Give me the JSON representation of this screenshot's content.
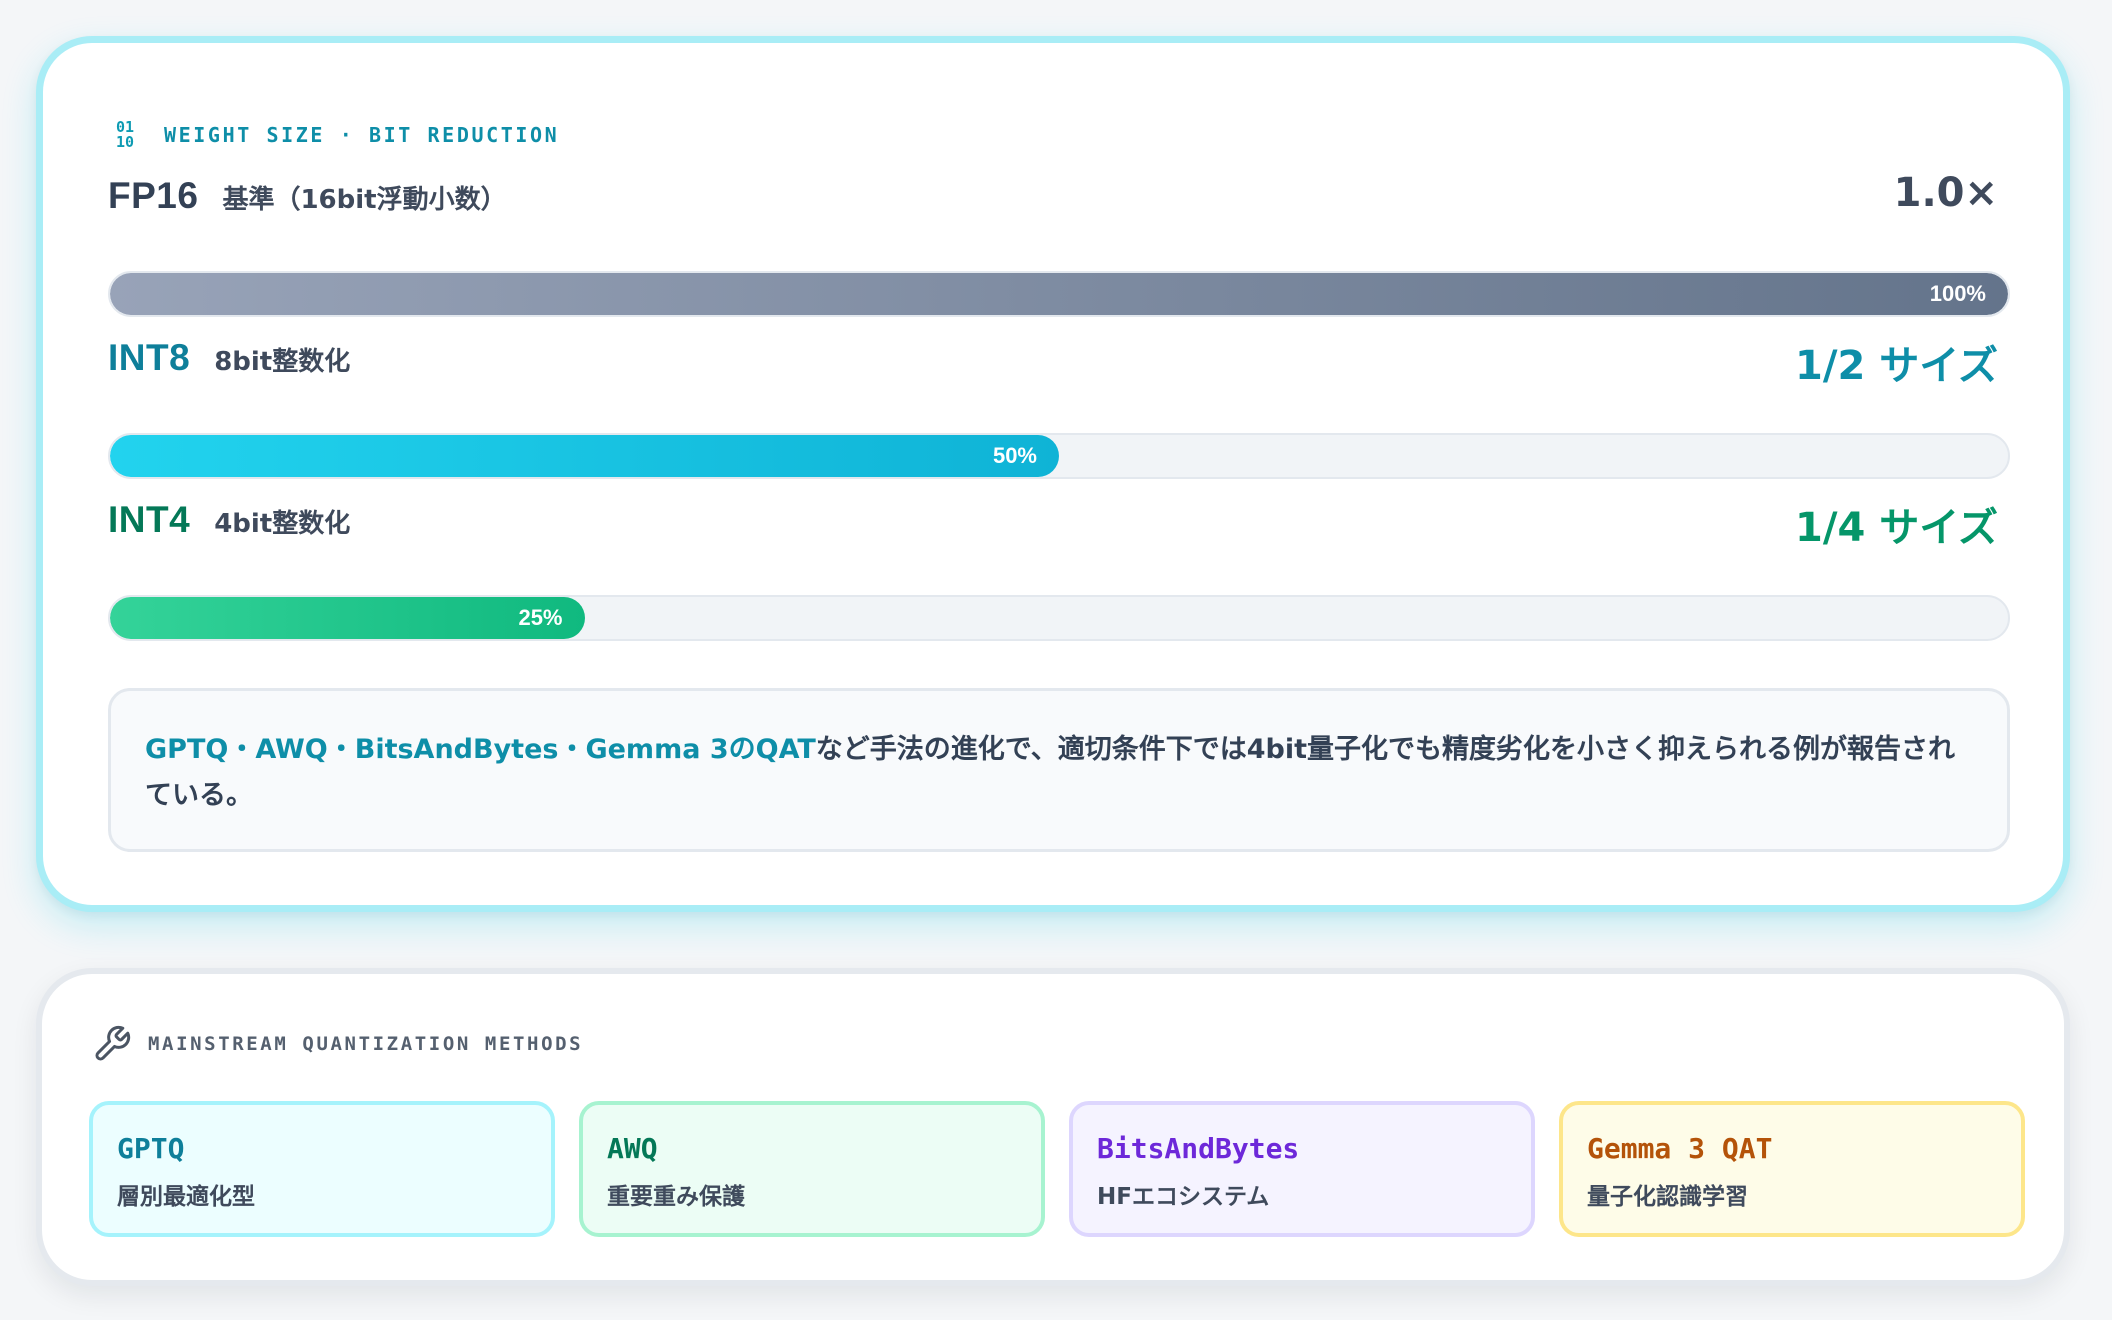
{
  "weight_section": {
    "header_icon": "binary-icon",
    "header_icon_text": [
      "01",
      "10"
    ],
    "header": "WEIGHT SIZE · BIT REDUCTION",
    "rows": [
      {
        "name": "FP16",
        "desc": "基準（16bit浮動小数）",
        "ratio": "1.0×",
        "percent_label": "100%",
        "fill_fraction": 1.0,
        "name_color": "#334155",
        "ratio_color": "#3f4a5c"
      },
      {
        "name": "INT8",
        "desc": "8bit整数化",
        "ratio": "1/2 サイズ",
        "percent_label": "50%",
        "fill_fraction": 0.5,
        "name_color": "#0e7f9a",
        "ratio_color": "#0e8ea8"
      },
      {
        "name": "INT4",
        "desc": "4bit整数化",
        "ratio": "1/4 サイズ",
        "percent_label": "25%",
        "fill_fraction": 0.25,
        "name_color": "#047857",
        "ratio_color": "#059669"
      }
    ],
    "note": {
      "highlight": "GPTQ・AWQ・BitsAndBytes・Gemma 3のQAT",
      "text": "など手法の進化で、適切条件下では4bit量子化でも精度劣化を小さく抑えられる例が報告されている。"
    }
  },
  "methods_section": {
    "header_icon": "wrench-icon",
    "title": "MAINSTREAM QUANTIZATION METHODS",
    "methods": [
      {
        "name": "GPTQ",
        "desc": "層別最適化型",
        "name_color": "#0e7f9a"
      },
      {
        "name": "AWQ",
        "desc": "重要重み保護",
        "name_color": "#047857"
      },
      {
        "name": "BitsAndBytes",
        "desc": "HFエコシステム",
        "name_color": "#6d28d9"
      },
      {
        "name": "Gemma 3 QAT",
        "desc": "量子化認識学習",
        "name_color": "#b45309"
      }
    ]
  }
}
